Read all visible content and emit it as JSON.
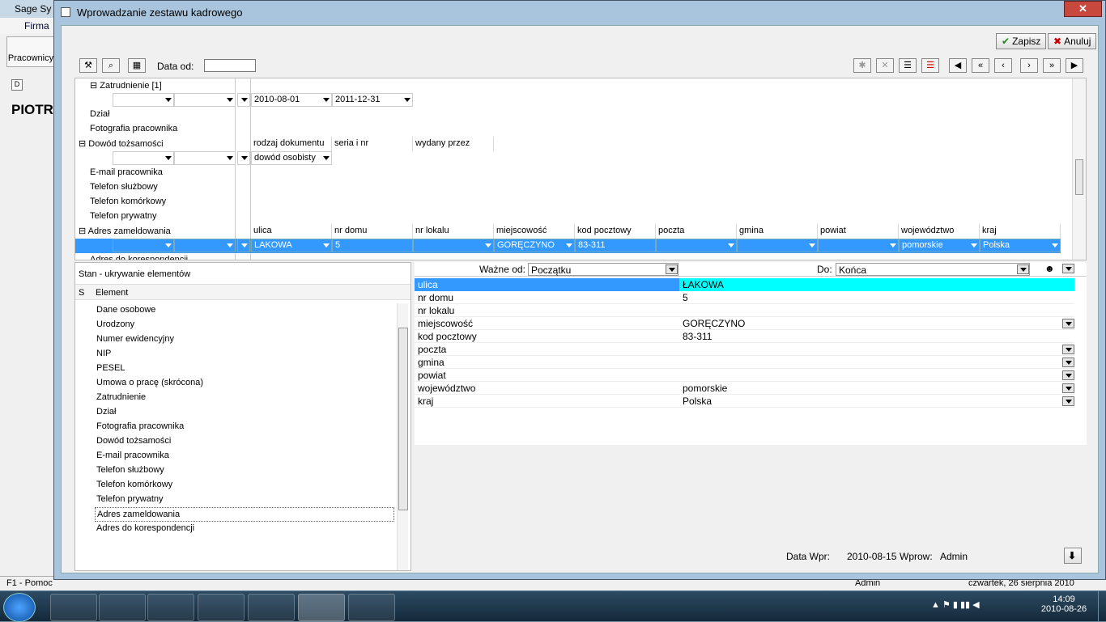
{
  "background": {
    "title": "Sage Sy",
    "menu": "Firma",
    "button": "Pracownicy",
    "big_text": "PIOTR",
    "status": "F1 - Pomoc",
    "status_user": "Admin",
    "status_date": "czwartek, 26 sierpnia 2010"
  },
  "window": {
    "title": "Wprowadzanie zestawu kadrowego",
    "close": "✕",
    "save": "Zapisz",
    "cancel": "Anuluj"
  },
  "toolbar": {
    "date_label": "Data od:",
    "date_value": ""
  },
  "grid": {
    "zatrudnienie": "Zatrudnienie [1]",
    "dates": [
      "2010-08-01",
      "2011-12-31"
    ],
    "dzial": "Dział",
    "foto": "Fotografia pracownika",
    "dowod": "Dowód tożsamości",
    "dowod_headers": [
      "rodzaj dokumentu",
      "seria i nr",
      "wydany przez"
    ],
    "dowod_value": "dowód osobisty",
    "email": "E-mail pracownika",
    "tel_sluz": "Telefon służbowy",
    "tel_kom": "Telefon komórkowy",
    "tel_pryw": "Telefon prywatny",
    "adres": "Adres zameldowania",
    "addr_headers": [
      "ulica",
      "nr domu",
      "nr lokalu",
      "miejscowość",
      "kod pocztowy",
      "poczta",
      "gmina",
      "powiat",
      "województwo",
      "kraj"
    ],
    "addr_values": [
      "LAKOWA",
      "5",
      "",
      "GORĘCZYNO",
      "83-311",
      "",
      "",
      "",
      "pomorskie",
      "Polska"
    ],
    "adres_kor": "Adres do korespondencji"
  },
  "left_panel": {
    "title": "Stan - ukrywanie elementów",
    "col_s": "S",
    "col_element": "Element",
    "items": [
      "Dane osobowe",
      "Urodzony",
      "Numer ewidencyjny",
      "NIP",
      "PESEL",
      "Umowa o pracę (skrócona)",
      "Zatrudnienie",
      "Dział",
      "Fotografia pracownika",
      "Dowód tożsamości",
      "E-mail pracownika",
      "Telefon służbowy",
      "Telefon komórkowy",
      "Telefon prywatny",
      "Adres zameldowania",
      "Adres do korespondencji"
    ]
  },
  "right_panel": {
    "wazne_label": "Ważne od:",
    "wazne_value": "Początku",
    "do_label": "Do:",
    "do_value": "Końca",
    "fields": [
      {
        "n": "ulica",
        "v": "ŁAKOWA"
      },
      {
        "n": "nr domu",
        "v": "5"
      },
      {
        "n": "nr lokalu",
        "v": ""
      },
      {
        "n": "miejscowość",
        "v": "GORĘCZYNO"
      },
      {
        "n": "kod pocztowy",
        "v": "83-311"
      },
      {
        "n": "poczta",
        "v": ""
      },
      {
        "n": "gmina",
        "v": ""
      },
      {
        "n": "powiat",
        "v": ""
      },
      {
        "n": "województwo",
        "v": "pomorskie"
      },
      {
        "n": "kraj",
        "v": "Polska"
      }
    ]
  },
  "footer": {
    "data_wpr_label": "Data Wpr:",
    "data_wpr": "2010-08-15",
    "wprow_label": "Wprow:",
    "wprow": "Admin"
  },
  "clock": {
    "time": "14:09",
    "date": "2010-08-26"
  },
  "colors": {
    "selection": "#3399ff",
    "highlight": "#00ffff"
  }
}
